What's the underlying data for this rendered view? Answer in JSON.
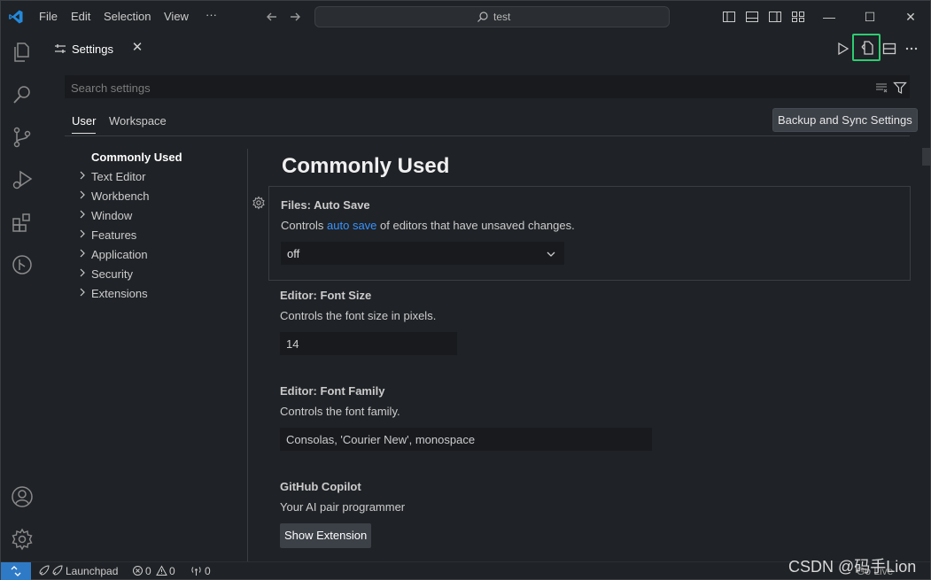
{
  "titlebar": {
    "menu": [
      "File",
      "Edit",
      "Selection",
      "View",
      "···"
    ],
    "search_text": "test"
  },
  "tab": {
    "label": "Settings"
  },
  "search": {
    "placeholder": "Search settings"
  },
  "scopes": [
    "User",
    "Workspace"
  ],
  "tooltip": "Backup and Sync Settings",
  "toc": [
    {
      "label": "Commonly Used",
      "active": true
    },
    {
      "label": "Text Editor"
    },
    {
      "label": "Workbench"
    },
    {
      "label": "Window"
    },
    {
      "label": "Features"
    },
    {
      "label": "Application"
    },
    {
      "label": "Security"
    },
    {
      "label": "Extensions"
    }
  ],
  "section_title": "Commonly Used",
  "settings": {
    "auto_save": {
      "category": "Files: ",
      "name": "Auto Save",
      "desc_before": "Controls ",
      "desc_link": "auto save",
      "desc_after": " of editors that have unsaved changes.",
      "value": "off"
    },
    "font_size": {
      "category": "Editor: ",
      "name": "Font Size",
      "desc": "Controls the font size in pixels.",
      "value": "14"
    },
    "font_family": {
      "category": "Editor: ",
      "name": "Font Family",
      "desc": "Controls the font family.",
      "value": "Consolas, 'Courier New', monospace"
    },
    "copilot": {
      "name": "GitHub Copilot",
      "desc": "Your AI pair programmer",
      "button": "Show Extension"
    }
  },
  "statusbar": {
    "launchpad": "Launchpad",
    "errors": "0",
    "warnings": "0",
    "ports": "0",
    "go_live": "Go Live"
  },
  "watermark": "CSDN @码手Lion",
  "colors": {
    "accent": "#3794ff",
    "highlight": "#2ecc71",
    "remote": "#2f7ac6"
  }
}
